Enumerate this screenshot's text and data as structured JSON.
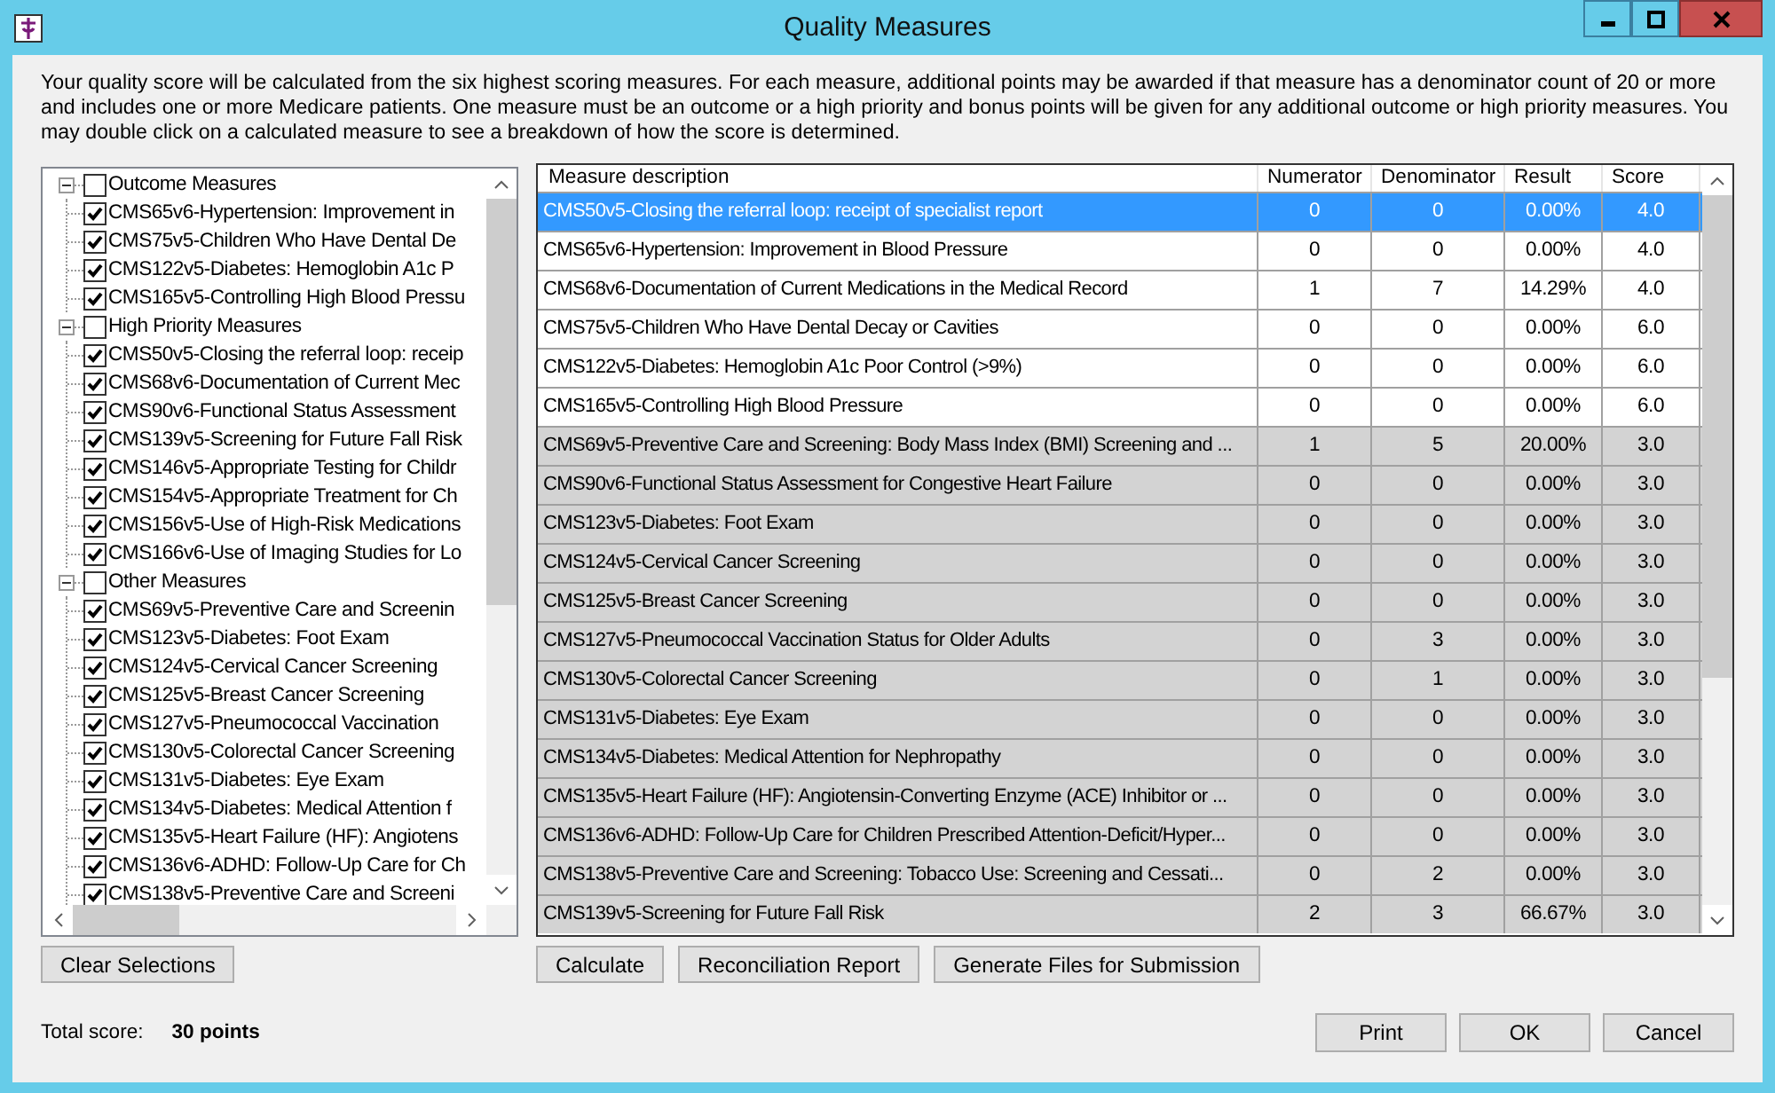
{
  "window": {
    "title": "Quality Measures"
  },
  "intro": "Your quality score will be calculated from the six highest scoring measures. For each measure, additional points may be awarded if that measure has a denominator count of 20 or more and includes one or more Medicare patients. One measure must be an outcome or a high priority and bonus points will be given for any additional outcome or high priority measures.  You may double click on a calculated measure to see a breakdown of how the score is determined.",
  "tree": [
    {
      "label": "Outcome Measures",
      "checked": false,
      "expanded": true,
      "children": [
        {
          "label": "CMS65v6-Hypertension: Improvement in",
          "checked": true
        },
        {
          "label": "CMS75v5-Children Who Have Dental De",
          "checked": true
        },
        {
          "label": "CMS122v5-Diabetes: Hemoglobin A1c P",
          "checked": true
        },
        {
          "label": "CMS165v5-Controlling High Blood Pressu",
          "checked": true
        }
      ]
    },
    {
      "label": "High Priority Measures",
      "checked": false,
      "expanded": true,
      "children": [
        {
          "label": "CMS50v5-Closing the referral loop: receip",
          "checked": true
        },
        {
          "label": "CMS68v6-Documentation of Current Mec",
          "checked": true
        },
        {
          "label": "CMS90v6-Functional Status Assessment",
          "checked": true
        },
        {
          "label": "CMS139v5-Screening for Future Fall Risk",
          "checked": true
        },
        {
          "label": "CMS146v5-Appropriate Testing for Childr",
          "checked": true
        },
        {
          "label": "CMS154v5-Appropriate Treatment for Ch",
          "checked": true
        },
        {
          "label": "CMS156v5-Use of High-Risk Medications",
          "checked": true
        },
        {
          "label": "CMS166v6-Use of Imaging Studies for Lo",
          "checked": true
        }
      ]
    },
    {
      "label": "Other Measures",
      "checked": false,
      "expanded": true,
      "children": [
        {
          "label": "CMS69v5-Preventive Care and Screenin",
          "checked": true
        },
        {
          "label": "CMS123v5-Diabetes: Foot Exam",
          "checked": true
        },
        {
          "label": "CMS124v5-Cervical Cancer Screening",
          "checked": true
        },
        {
          "label": "CMS125v5-Breast Cancer Screening",
          "checked": true
        },
        {
          "label": "CMS127v5-Pneumococcal Vaccination",
          "checked": true
        },
        {
          "label": "CMS130v5-Colorectal Cancer Screening",
          "checked": true
        },
        {
          "label": "CMS131v5-Diabetes: Eye Exam",
          "checked": true
        },
        {
          "label": "CMS134v5-Diabetes: Medical Attention f",
          "checked": true
        },
        {
          "label": "CMS135v5-Heart Failure (HF): Angiotens",
          "checked": true
        },
        {
          "label": "CMS136v6-ADHD: Follow-Up Care for Ch",
          "checked": true
        },
        {
          "label": "CMS138v5-Preventive Care and Screeni",
          "checked": true
        }
      ]
    }
  ],
  "clear_button": "Clear Selections",
  "table": {
    "columns": [
      "Measure description",
      "Numerator",
      "Denominator",
      "Result",
      "Score"
    ],
    "rows": [
      {
        "cells": [
          "CMS50v5-Closing the referral loop: receipt of specialist report",
          "0",
          "0",
          "0.00%",
          "4.0"
        ],
        "selected": true,
        "counted": true
      },
      {
        "cells": [
          "CMS65v6-Hypertension: Improvement in Blood Pressure",
          "0",
          "0",
          "0.00%",
          "4.0"
        ],
        "selected": false,
        "counted": true
      },
      {
        "cells": [
          "CMS68v6-Documentation of Current Medications in the Medical Record",
          "1",
          "7",
          "14.29%",
          "4.0"
        ],
        "selected": false,
        "counted": true
      },
      {
        "cells": [
          "CMS75v5-Children Who Have Dental Decay or Cavities",
          "0",
          "0",
          "0.00%",
          "6.0"
        ],
        "selected": false,
        "counted": true
      },
      {
        "cells": [
          "CMS122v5-Diabetes: Hemoglobin A1c Poor Control (>9%)",
          "0",
          "0",
          "0.00%",
          "6.0"
        ],
        "selected": false,
        "counted": true
      },
      {
        "cells": [
          "CMS165v5-Controlling High Blood Pressure",
          "0",
          "0",
          "0.00%",
          "6.0"
        ],
        "selected": false,
        "counted": true
      },
      {
        "cells": [
          "CMS69v5-Preventive Care and Screening: Body Mass Index (BMI) Screening and ...",
          "1",
          "5",
          "20.00%",
          "3.0"
        ],
        "selected": false,
        "counted": false
      },
      {
        "cells": [
          "CMS90v6-Functional Status Assessment for Congestive Heart Failure",
          "0",
          "0",
          "0.00%",
          "3.0"
        ],
        "selected": false,
        "counted": false
      },
      {
        "cells": [
          "CMS123v5-Diabetes: Foot Exam",
          "0",
          "0",
          "0.00%",
          "3.0"
        ],
        "selected": false,
        "counted": false
      },
      {
        "cells": [
          "CMS124v5-Cervical Cancer Screening",
          "0",
          "0",
          "0.00%",
          "3.0"
        ],
        "selected": false,
        "counted": false
      },
      {
        "cells": [
          "CMS125v5-Breast Cancer Screening",
          "0",
          "0",
          "0.00%",
          "3.0"
        ],
        "selected": false,
        "counted": false
      },
      {
        "cells": [
          "CMS127v5-Pneumococcal Vaccination Status for Older Adults",
          "0",
          "3",
          "0.00%",
          "3.0"
        ],
        "selected": false,
        "counted": false
      },
      {
        "cells": [
          "CMS130v5-Colorectal Cancer Screening",
          "0",
          "1",
          "0.00%",
          "3.0"
        ],
        "selected": false,
        "counted": false
      },
      {
        "cells": [
          "CMS131v5-Diabetes: Eye Exam",
          "0",
          "0",
          "0.00%",
          "3.0"
        ],
        "selected": false,
        "counted": false
      },
      {
        "cells": [
          "CMS134v5-Diabetes: Medical Attention for Nephropathy",
          "0",
          "0",
          "0.00%",
          "3.0"
        ],
        "selected": false,
        "counted": false
      },
      {
        "cells": [
          "CMS135v5-Heart Failure (HF): Angiotensin-Converting Enzyme (ACE) Inhibitor or  ...",
          "0",
          "0",
          "0.00%",
          "3.0"
        ],
        "selected": false,
        "counted": false
      },
      {
        "cells": [
          "CMS136v6-ADHD: Follow-Up Care for Children Prescribed Attention-Deficit/Hyper...",
          "0",
          "0",
          "0.00%",
          "3.0"
        ],
        "selected": false,
        "counted": false
      },
      {
        "cells": [
          "CMS138v5-Preventive Care and Screening: Tobacco Use: Screening and Cessati...",
          "0",
          "2",
          "0.00%",
          "3.0"
        ],
        "selected": false,
        "counted": false
      },
      {
        "cells": [
          "CMS139v5-Screening for Future Fall Risk",
          "2",
          "3",
          "66.67%",
          "3.0"
        ],
        "selected": false,
        "counted": false
      }
    ]
  },
  "table_buttons": [
    "Calculate",
    "Reconciliation Report",
    "Generate Files for Submission"
  ],
  "total_label": "Total score:",
  "total_value": "30 points",
  "dialog_buttons": [
    "Print",
    "OK",
    "Cancel"
  ]
}
